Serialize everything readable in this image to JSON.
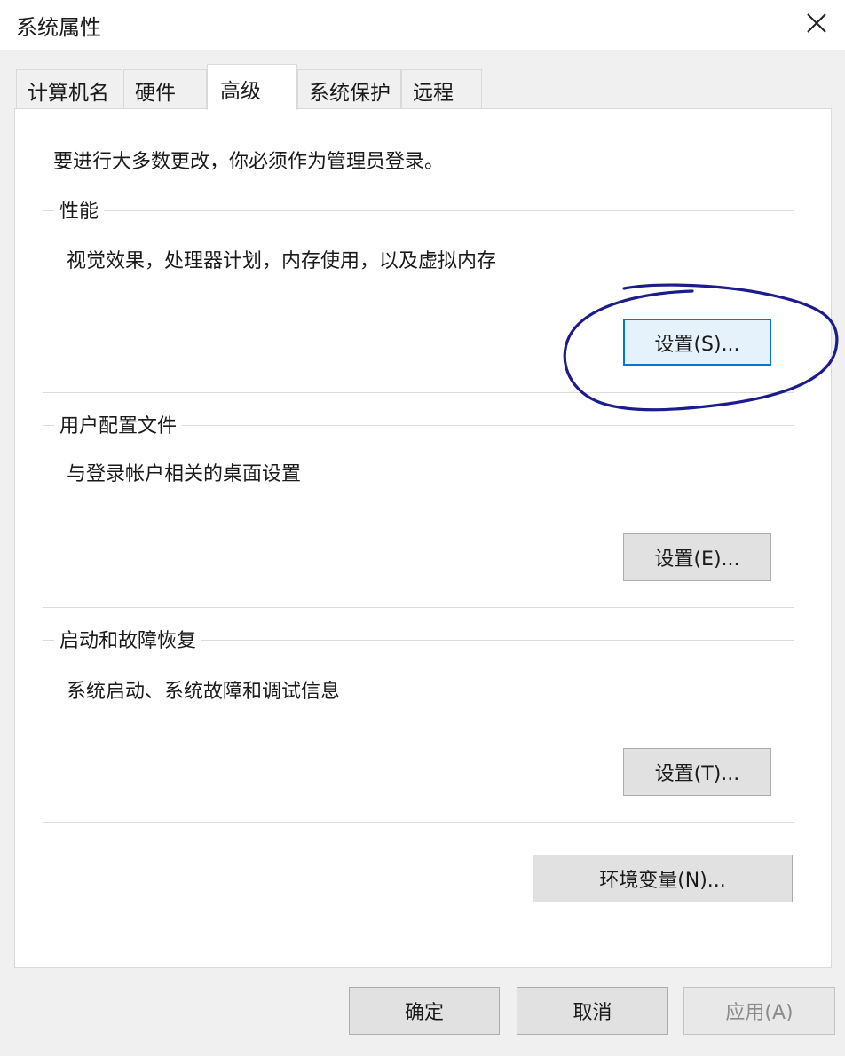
{
  "window": {
    "title": "系统属性",
    "close_icon": "close-icon"
  },
  "tabs": [
    {
      "label": "计算机名",
      "active": false
    },
    {
      "label": "硬件",
      "active": false
    },
    {
      "label": "高级",
      "active": true
    },
    {
      "label": "系统保护",
      "active": false
    },
    {
      "label": "远程",
      "active": false
    }
  ],
  "intro": "要进行大多数更改，你必须作为管理员登录。",
  "groups": {
    "performance": {
      "title": "性能",
      "description": "视觉效果，处理器计划，内存使用，以及虚拟内存",
      "button": "设置(S)..."
    },
    "user_profiles": {
      "title": "用户配置文件",
      "description": "与登录帐户相关的桌面设置",
      "button": "设置(E)..."
    },
    "startup_recovery": {
      "title": "启动和故障恢复",
      "description": "系统启动、系统故障和调试信息",
      "button": "设置(T)..."
    }
  },
  "env_button": "环境变量(N)...",
  "footer": {
    "ok": "确定",
    "cancel": "取消",
    "apply": "应用(A)"
  },
  "colors": {
    "annotation": "#1c1c8c",
    "focus": "#0078d7"
  }
}
